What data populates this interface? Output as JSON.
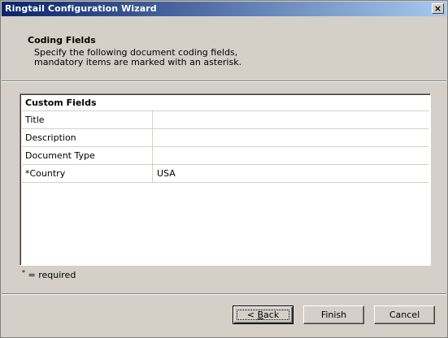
{
  "window": {
    "title": "Ringtail Configuration Wizard",
    "close_glyph": "✕"
  },
  "header": {
    "title": "Coding Fields",
    "desc_line1": "Specify the following document coding fields,",
    "desc_line2": "mandatory items are marked with an asterisk."
  },
  "grid": {
    "heading": "Custom Fields",
    "rows": [
      {
        "name": "Title",
        "value": ""
      },
      {
        "name": "Description",
        "value": ""
      },
      {
        "name": "Document Type",
        "value": ""
      },
      {
        "name": "*Country",
        "value": "USA"
      }
    ]
  },
  "footnote": {
    "asterisk": "*",
    "text": " = required"
  },
  "buttons": {
    "back_prefix": "< ",
    "back_accel": "B",
    "back_rest": "ack",
    "finish": "Finish",
    "cancel": "Cancel"
  },
  "colors": {
    "title_start": "#0a246a",
    "title_end": "#a6caf0",
    "face": "#d4d0c8"
  }
}
